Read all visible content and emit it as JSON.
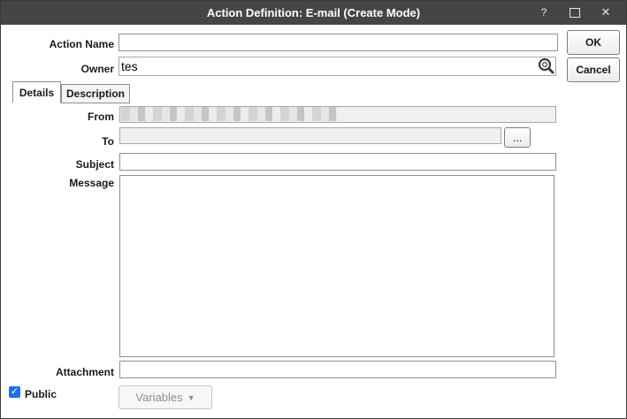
{
  "window": {
    "title": "Action Definition: E-mail (Create Mode)",
    "help_label": "?",
    "close_label": "✕"
  },
  "buttons": {
    "ok_label": "OK",
    "cancel_label": "Cancel",
    "browse_label": "...",
    "variables_label": "Variables",
    "variables_caret": "▼"
  },
  "tabs": [
    {
      "label": "Details",
      "active": true
    },
    {
      "label": "Description",
      "active": false
    }
  ],
  "form": {
    "action_name": {
      "label": "Action Name",
      "value": ""
    },
    "owner": {
      "label": "Owner",
      "value": "tes"
    },
    "from": {
      "label": "From",
      "value": ""
    },
    "to": {
      "label": "To",
      "value": ""
    },
    "subject": {
      "label": "Subject",
      "value": ""
    },
    "message": {
      "label": "Message",
      "value": ""
    },
    "attachment": {
      "label": "Attachment",
      "value": ""
    },
    "public": {
      "label": "Public",
      "checked": true,
      "check_glyph": "✓"
    }
  },
  "icons": {
    "owner_search": "search-icon",
    "public_checkbox": "checkbox-checked-icon"
  }
}
